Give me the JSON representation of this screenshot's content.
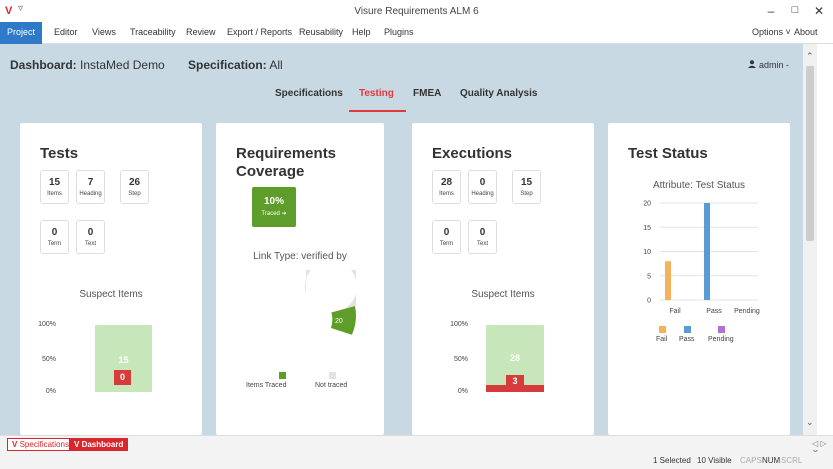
{
  "window": {
    "title": "Visure Requirements ALM 6",
    "logo": "V",
    "quick_access": "▿",
    "minimize": "–",
    "maximize": "□",
    "close": "✕"
  },
  "menu": {
    "items": [
      "Project",
      "Editor",
      "Views",
      "Traceability",
      "Review",
      "Export / Reports",
      "Reusability",
      "Help",
      "Plugins"
    ],
    "options": "Options ˅",
    "about": "About"
  },
  "dashboard": {
    "label": "Dashboard:",
    "name": "InstaMed Demo",
    "spec_label": "Specification:",
    "spec_value": "All",
    "user": "admin -",
    "tabs": [
      "Specifications",
      "Testing",
      "FMEA",
      "Quality Analysis"
    ],
    "active_tab": "Testing"
  },
  "tests": {
    "title": "Tests",
    "stats": [
      {
        "value": "15",
        "label": "Items"
      },
      {
        "value": "7",
        "label": "Heading"
      },
      {
        "value": "26",
        "label": "Step"
      },
      {
        "value": "0",
        "label": "Term"
      },
      {
        "value": "0",
        "label": "Text"
      }
    ],
    "suspect_title": "Suspect Items",
    "axis": [
      "100%",
      "50%",
      "0%"
    ],
    "bar_total": "15",
    "bar_suspect": "0"
  },
  "coverage": {
    "title_line1": "Requirements",
    "title_line2": "Coverage",
    "percent": "10%",
    "traced_link": "Traced ➔",
    "link_type": "Link Type:  verified by",
    "donut_not_traced": "180",
    "donut_traced": "20",
    "legend": [
      "Items Traced",
      "Not traced"
    ],
    "colors": {
      "traced": "#5e9d2a",
      "not_traced": "#e3e3e3"
    }
  },
  "executions": {
    "title": "Executions",
    "stats": [
      {
        "value": "28",
        "label": "Items"
      },
      {
        "value": "0",
        "label": "Heading"
      },
      {
        "value": "15",
        "label": "Step"
      },
      {
        "value": "0",
        "label": "Term"
      },
      {
        "value": "0",
        "label": "Text"
      }
    ],
    "suspect_title": "Suspect Items",
    "axis": [
      "100%",
      "50%",
      "0%"
    ],
    "bar_total": "28",
    "bar_suspect": "3"
  },
  "chart_data": {
    "type": "bar",
    "title": "Test Status",
    "subtitle": "Attribute:  Test Status",
    "categories": [
      "Fail",
      "Pass",
      "Pending"
    ],
    "values": [
      8,
      20,
      0
    ],
    "colors": [
      "#f5b25e",
      "#5b9bd5",
      "#b36fd1"
    ],
    "yticks": [
      "20",
      "15",
      "10",
      "5",
      "0"
    ],
    "ylim": [
      0,
      20
    ],
    "legend": [
      "Fail",
      "Pass",
      "Pending"
    ]
  },
  "bottom_tabs": [
    "Specifications",
    "Dashboard"
  ],
  "status": {
    "selected": "1 Selected",
    "visible": "10 Visible",
    "caps": "CAPS",
    "num": "NUM",
    "scrl": "SCRL"
  }
}
